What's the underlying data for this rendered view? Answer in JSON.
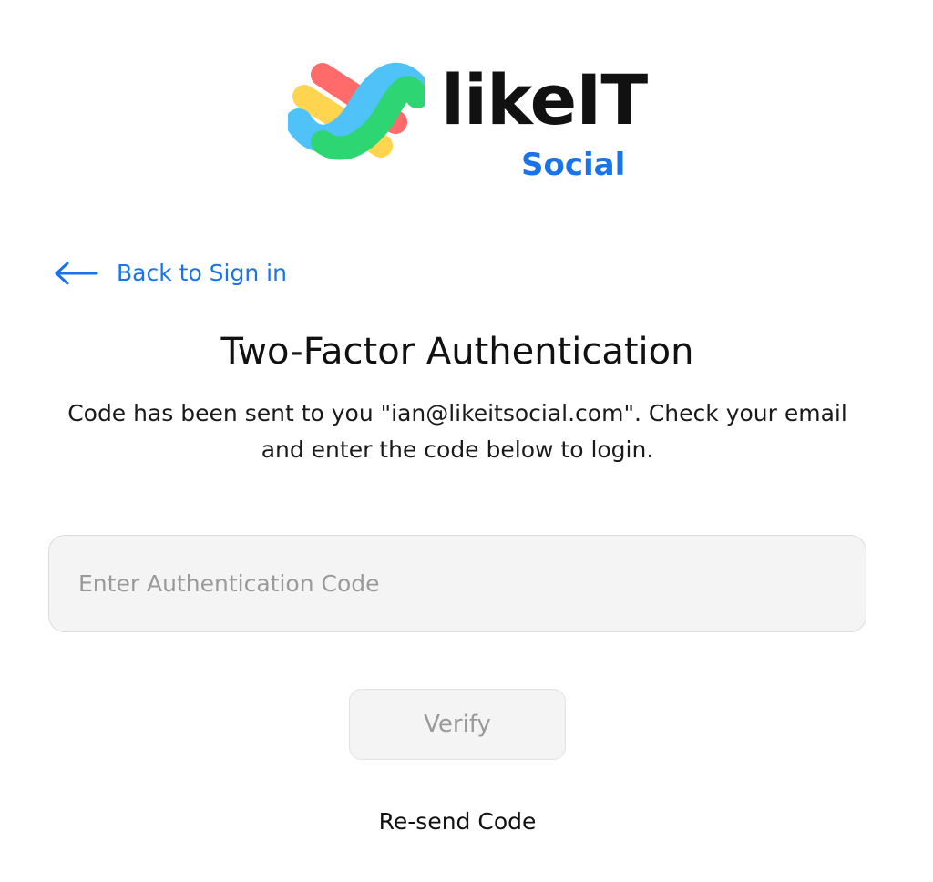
{
  "brand": {
    "name": "likeIT",
    "sub": "Social",
    "accent_color": "#1a73e8",
    "logo_colors": [
      "#ff6b6b",
      "#ffd54f",
      "#4fc3f7",
      "#2ed573",
      "#29b6f6"
    ]
  },
  "nav": {
    "back_label": "Back to Sign in",
    "back_icon": "arrow-left-icon"
  },
  "page": {
    "title": "Two-Factor Authentication",
    "description": "Code has been sent to you \"ian@likeitsocial.com\". Check your email and enter the code below to login."
  },
  "form": {
    "code_placeholder": "Enter Authentication Code",
    "code_value": "",
    "verify_label": "Verify",
    "resend_label": "Re-send Code"
  }
}
